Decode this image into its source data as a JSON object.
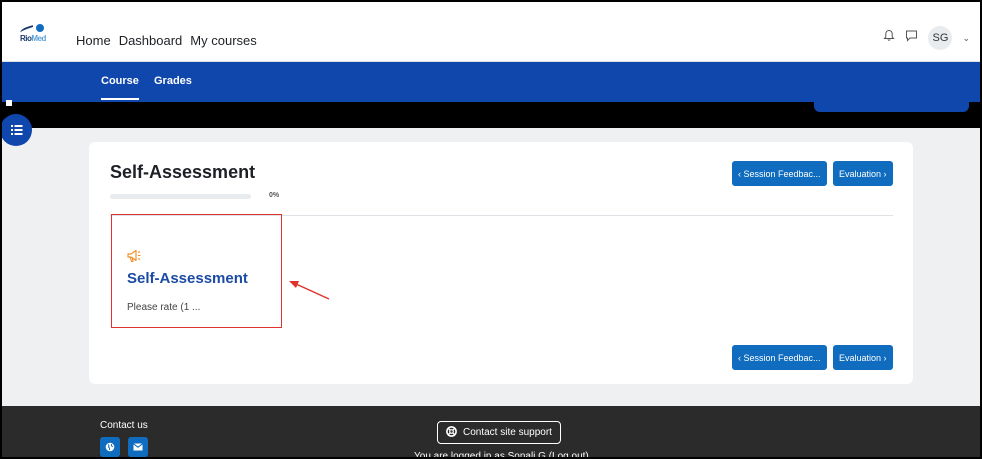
{
  "nav": {
    "logo_text": "Rio",
    "logo_text_accent": "Med",
    "links": [
      "Home",
      "Dashboard",
      "My courses"
    ],
    "user_initials": "SG"
  },
  "secondary_nav": {
    "tabs": [
      "Course",
      "Grades"
    ],
    "active": "Course"
  },
  "card": {
    "title": "Self-Assessment",
    "progress_percent_label": "0%",
    "progress_value": 0,
    "prev_button": "‹ Session Feedbac...",
    "next_button": "Evaluation ›"
  },
  "activity": {
    "icon": "megaphone-icon",
    "title": "Self-Assessment",
    "description": "Please rate (1 ..."
  },
  "footer": {
    "contact_label": "Contact us",
    "support_button": "Contact site support",
    "logged_in_text": "You are logged in as Sonali G (Log out)"
  },
  "colors": {
    "primary_blue": "#0f47ad",
    "button_blue": "#0f6cbf",
    "activity_title": "#1b4ba4",
    "highlight_red": "#e0322c",
    "megaphone_orange": "#f0922e",
    "footer_bg": "#2b2b2b"
  }
}
